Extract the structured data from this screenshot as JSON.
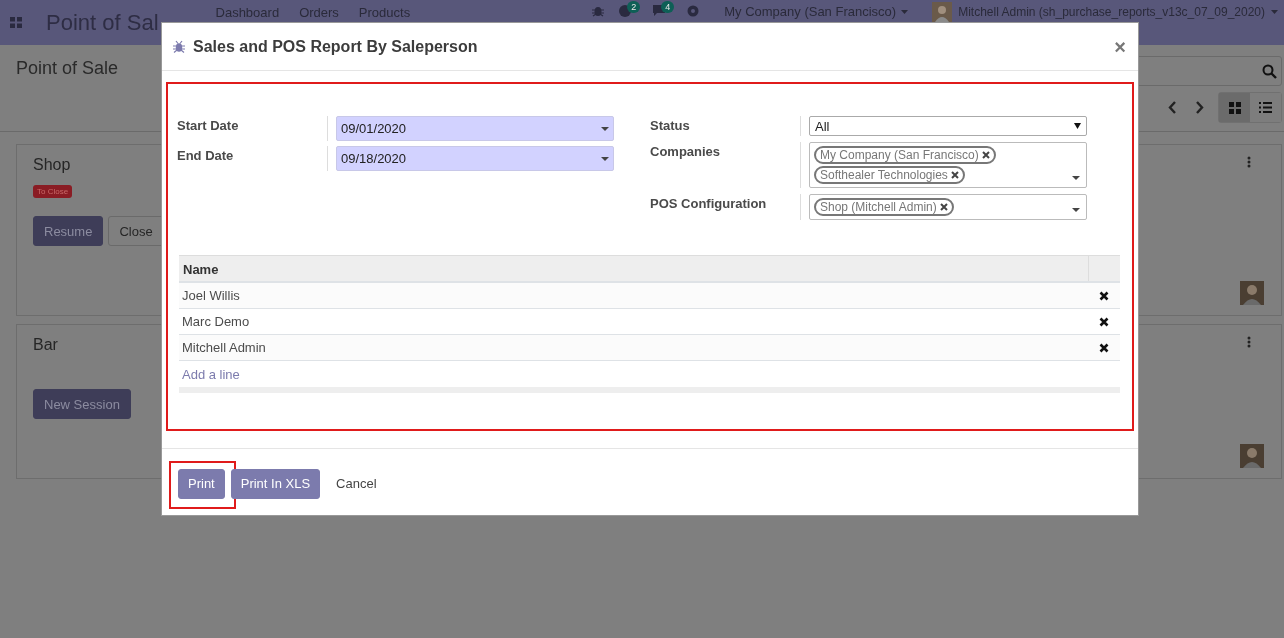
{
  "navbar": {
    "app_title": "Point of Sal",
    "menu": [
      "Dashboard",
      "Orders",
      "Products"
    ],
    "activity_count": "2",
    "message_count": "4",
    "company": "My Company (San Francisco)",
    "user": "Mitchell Admin (sh_purchase_reports_v13c_07_09_2020)"
  },
  "control_panel": {
    "breadcrumb": "Point of Sale",
    "views": [
      {
        "kind": "kanban",
        "selected": true
      },
      {
        "kind": "list",
        "selected": false
      }
    ]
  },
  "kanban": [
    {
      "name": "Shop",
      "badge": "To Close",
      "buttons": [
        {
          "label": "Resume",
          "kind": "primary"
        },
        {
          "label": "Close",
          "kind": "secondary"
        }
      ]
    },
    {
      "name": "Bar",
      "buttons": [
        {
          "label": "New Session",
          "kind": "primary"
        }
      ]
    }
  ],
  "dialog": {
    "title": "Sales and POS Report By Saleperson",
    "close": "×",
    "left_fields": [
      {
        "label": "Start Date",
        "value": "09/01/2020"
      },
      {
        "label": "End Date",
        "value": "09/18/2020"
      }
    ],
    "right_fields": [
      {
        "label": "Status",
        "kind": "select",
        "value": "All"
      },
      {
        "label": "Companies",
        "kind": "tags",
        "tags": [
          "My Company (San Francisco)",
          "Softhealer Technologies"
        ]
      },
      {
        "label": "POS Configuration",
        "kind": "tags",
        "tags": [
          "Shop (Mitchell Admin)"
        ]
      }
    ],
    "table": {
      "columns": [
        "Name"
      ],
      "rows": [
        "Joel Willis",
        "Marc Demo",
        "Mitchell Admin"
      ],
      "add_line": "Add a line"
    },
    "buttons": [
      {
        "label": "Print",
        "kind": "primary",
        "highlighted": true
      },
      {
        "label": "Print In XLS",
        "kind": "primary",
        "highlighted": false
      },
      {
        "label": "Cancel",
        "kind": "link",
        "highlighted": false
      }
    ]
  }
}
